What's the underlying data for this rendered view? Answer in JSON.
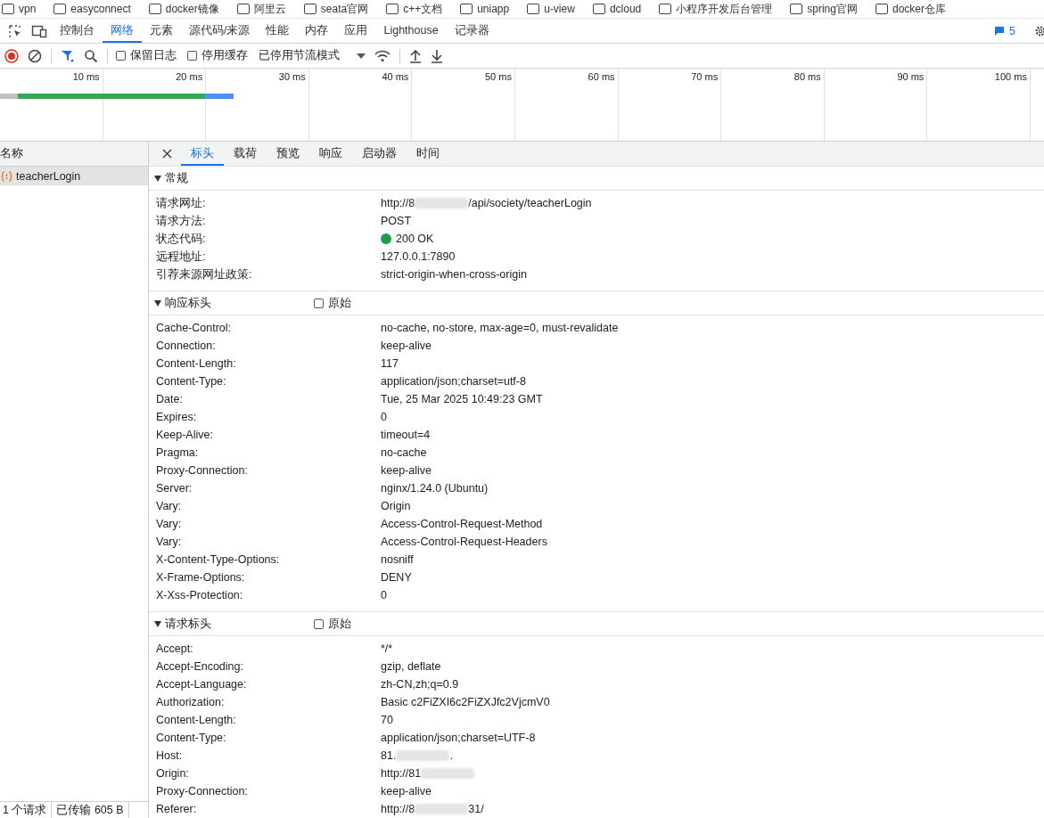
{
  "bookmarks": [
    "vpn",
    "easyconnect",
    "docker镜像",
    "阿里云",
    "seata官网",
    "c++文档",
    "uniapp",
    "u-view",
    "dcloud",
    "小程序开发后台管理",
    "spring官网",
    "docker仓库"
  ],
  "devtools_tabs": [
    {
      "label": "控制台",
      "selected": false
    },
    {
      "label": "网络",
      "selected": true
    },
    {
      "label": "元素",
      "selected": false
    },
    {
      "label": "源代码/来源",
      "selected": false
    },
    {
      "label": "性能",
      "selected": false
    },
    {
      "label": "内存",
      "selected": false
    },
    {
      "label": "应用",
      "selected": false
    },
    {
      "label": "Lighthouse",
      "selected": false
    },
    {
      "label": "记录器",
      "selected": false
    }
  ],
  "issues_count": "5",
  "toolbar": {
    "recording": true,
    "preserve_log": {
      "label": "保留日志",
      "checked": false
    },
    "disable_cache": {
      "label": "停用缓存",
      "checked": false
    },
    "throttling": "已停用节流模式"
  },
  "timeline_ticks": [
    "10 ms",
    "20 ms",
    "30 ms",
    "40 ms",
    "50 ms",
    "60 ms",
    "70 ms",
    "80 ms",
    "90 ms",
    "100 ms"
  ],
  "requests": {
    "column": "名称",
    "items": [
      {
        "name": "teacherLogin",
        "selected": true
      }
    ]
  },
  "status_bar": [
    "1 个请求",
    "已传输 605 B"
  ],
  "detail_tabs": [
    {
      "label": "标头",
      "selected": true
    },
    {
      "label": "载荷",
      "selected": false
    },
    {
      "label": "预览",
      "selected": false
    },
    {
      "label": "响应",
      "selected": false
    },
    {
      "label": "启动器",
      "selected": false
    },
    {
      "label": "时间",
      "selected": false
    }
  ],
  "sections": [
    {
      "title": "常规",
      "expanded": true,
      "rows": [
        {
          "name": "请求网址:",
          "value": "http://8",
          "masked": true,
          "suffix": "/api/society/teacherLogin"
        },
        {
          "name": "请求方法:",
          "value": "POST"
        },
        {
          "name": "状态代码:",
          "value": "200 OK",
          "color": "#1e9e45"
        },
        {
          "name": "远程地址:",
          "value": "127.0.0.1:7890"
        },
        {
          "name": "引荐来源网址政策:",
          "value": "strict-origin-when-cross-origin"
        }
      ]
    },
    {
      "title": "响应标头",
      "expanded": true,
      "raw": {
        "label": "原始",
        "checked": false
      },
      "rows": [
        {
          "name": "Cache-Control:",
          "value": "no-cache, no-store, max-age=0, must-revalidate"
        },
        {
          "name": "Connection:",
          "value": "keep-alive"
        },
        {
          "name": "Content-Length:",
          "value": "117"
        },
        {
          "name": "Content-Type:",
          "value": "application/json;charset=utf-8"
        },
        {
          "name": "Date:",
          "value": "Tue, 25 Mar 2025 10:49:23 GMT"
        },
        {
          "name": "Expires:",
          "value": "0"
        },
        {
          "name": "Keep-Alive:",
          "value": "timeout=4"
        },
        {
          "name": "Pragma:",
          "value": "no-cache"
        },
        {
          "name": "Proxy-Connection:",
          "value": "keep-alive"
        },
        {
          "name": "Server:",
          "value": "nginx/1.24.0 (Ubuntu)"
        },
        {
          "name": "Vary:",
          "value": "Origin"
        },
        {
          "name": "Vary:",
          "value": "Access-Control-Request-Method"
        },
        {
          "name": "Vary:",
          "value": "Access-Control-Request-Headers"
        },
        {
          "name": "X-Content-Type-Options:",
          "value": "nosniff"
        },
        {
          "name": "X-Frame-Options:",
          "value": "DENY"
        },
        {
          "name": "X-Xss-Protection:",
          "value": "0"
        }
      ]
    },
    {
      "title": "请求标头",
      "expanded": true,
      "raw": {
        "label": "原始",
        "checked": false
      },
      "rows": [
        {
          "name": "Accept:",
          "value": "*/*"
        },
        {
          "name": "Accept-Encoding:",
          "value": "gzip, deflate"
        },
        {
          "name": "Accept-Language:",
          "value": "zh-CN,zh;q=0.9"
        },
        {
          "name": "Authorization:",
          "value": "Basic c2FiZXI6c2FiZXJfc2VjcmV0"
        },
        {
          "name": "Content-Length:",
          "value": "70"
        },
        {
          "name": "Content-Type:",
          "value": "application/json;charset=UTF-8"
        },
        {
          "name": "Host:",
          "value": "81.",
          "masked": true,
          "suffix": "."
        },
        {
          "name": "Origin:",
          "value": "http://81",
          "masked": true
        },
        {
          "name": "Proxy-Connection:",
          "value": "keep-alive"
        },
        {
          "name": "Referer:",
          "value": "http://8",
          "masked": true,
          "suffix": "31/"
        }
      ]
    }
  ]
}
